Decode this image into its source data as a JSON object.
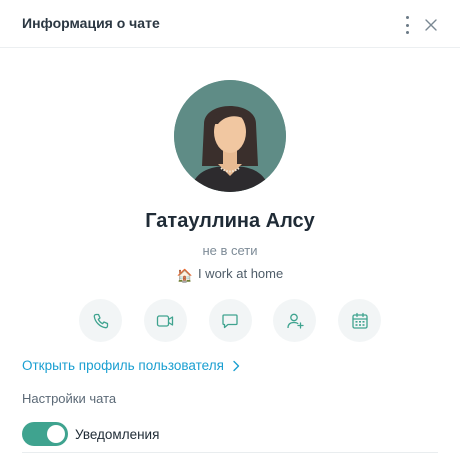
{
  "header": {
    "title": "Информация о чате",
    "more_icon": "kebab-vertical-icon",
    "close_icon": "close-icon"
  },
  "profile": {
    "avatar": "user-avatar-photo",
    "name": "Гатауллина Алсу",
    "presence": "не в сети",
    "status_emoji": "🏠",
    "status_text": "I work at home"
  },
  "actions": [
    {
      "icon": "phone-icon"
    },
    {
      "icon": "video-icon"
    },
    {
      "icon": "chat-bubble-icon"
    },
    {
      "icon": "add-user-icon"
    },
    {
      "icon": "calendar-icon"
    }
  ],
  "links": {
    "open_profile": "Открыть профиль пользователя"
  },
  "settings": {
    "section_label": "Настройки чата",
    "notifications_label": "Уведомления",
    "notifications_on": true
  },
  "colors": {
    "accent": "#3fa38f",
    "link": "#1a9fd1",
    "icon": "#3fa38f"
  }
}
